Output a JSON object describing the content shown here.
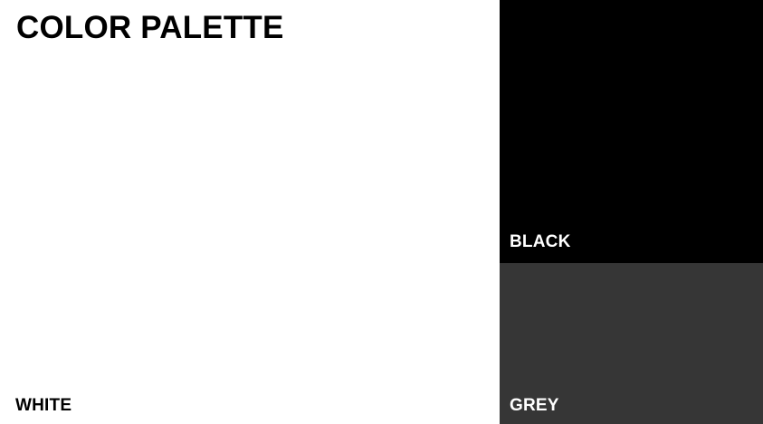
{
  "title": "COLOR PALETTE",
  "swatches": [
    {
      "name": "WHITE",
      "color": "#ffffff"
    },
    {
      "name": "BLACK",
      "color": "#000000"
    },
    {
      "name": "GREY",
      "color": "#363636"
    }
  ]
}
